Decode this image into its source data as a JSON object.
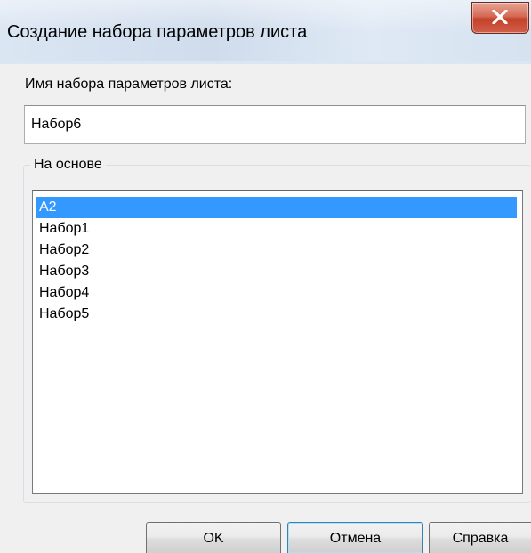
{
  "window": {
    "title": "Создание набора параметров листа",
    "close_icon": "close-icon"
  },
  "name_field": {
    "label": "Имя  набора параметров листа:",
    "value": "Набор6"
  },
  "based_on": {
    "label": "На основе",
    "items": [
      {
        "label": "A2",
        "selected": true
      },
      {
        "label": "Набор1",
        "selected": false
      },
      {
        "label": "Набор2",
        "selected": false
      },
      {
        "label": "Набор3",
        "selected": false
      },
      {
        "label": "Набор4",
        "selected": false
      },
      {
        "label": "Набор5",
        "selected": false
      }
    ]
  },
  "buttons": {
    "ok": "OK",
    "cancel": "Отмена",
    "help": "Справка"
  },
  "colors": {
    "selection": "#3399ff",
    "close_button": "#c4412a",
    "default_button_border": "#3c7fb1"
  }
}
